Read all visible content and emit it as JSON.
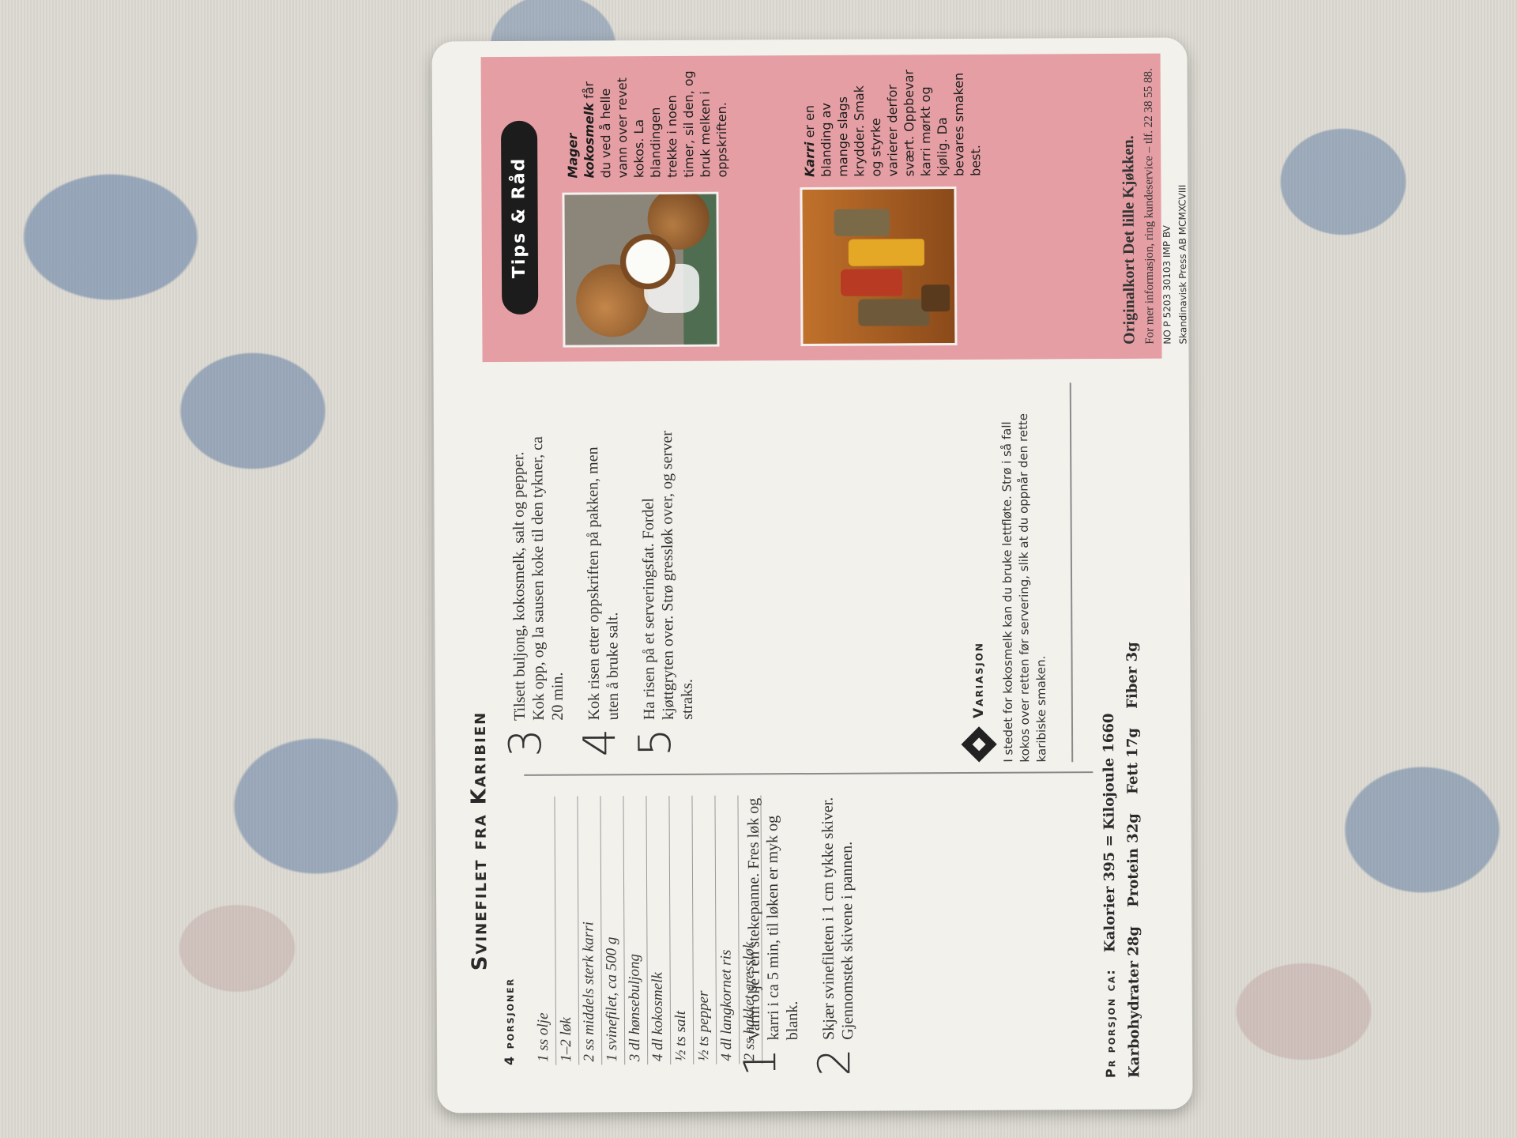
{
  "recipe": {
    "title": "Svinefilet fra Karibien",
    "servings": "4 porsjoner",
    "ingredients": [
      "1 ss olje",
      "1–2 løk",
      "2 ss middels sterk karri",
      "1 svinefilet, ca 500 g",
      "3 dl hønsebuljong",
      "4 dl kokosmelk",
      "½ ts salt",
      "½ ts pepper",
      "4 dl langkornet ris",
      "2 ss hakket gressløk"
    ],
    "steps": [
      {
        "num": "1",
        "text": "Varm olje i en stekepanne. Fres løk og karri i ca 5 min, til løken er myk og blank."
      },
      {
        "num": "2",
        "text": "Skjær svinefileten i 1 cm tykke skiver. Gjennomstek skivene i pannen."
      },
      {
        "num": "3",
        "text": "Tilsett buljong, kokosmelk, salt og pepper. Kok opp, og la sausen koke til den tykner, ca 20 min."
      },
      {
        "num": "4",
        "text": "Kok risen etter oppskriften på pakken, men uten å bruke salt."
      },
      {
        "num": "5",
        "text": "Ha risen på et serveringsfat. Fordel kjøttgryten over. Strø gressløk over, og server straks."
      }
    ],
    "variation": {
      "heading": "Variasjon",
      "text": "I stedet for kokosmelk kan du bruke lettfløte. Strø i så fall kokos over retten før servering, slik at du oppnår den rette karibiske smaken."
    },
    "nutrition": {
      "label": "Pr porsjon ca:",
      "line1": "Kalorier 395 = Kilojoule 1660",
      "carbs": "Karbohydrater 28g",
      "protein": "Protein 32g",
      "fat": "Fett 17g",
      "fiber": "Fiber 3g"
    }
  },
  "tips": {
    "badge": "Tips & Råd",
    "tip1_bold": "Mager kokosmelk",
    "tip1_text": " får du ved å helle vann over revet kokos. La blandingen trekke i noen timer, sil den, og bruk melken i oppskriften.",
    "tip2_bold": "Karri",
    "tip2_text": " er en blanding av mange slags krydder. Smak og styrke varierer derfor svært. Oppbevar karri mørkt og kjølig. Da bevares smaken best."
  },
  "footer": {
    "origin": "Originalkort Det lille Kjøkken.",
    "info": "For mer informasjon, ring kundeservice – tlf. 22 38 55 88.",
    "code1": "NO P 5203 30103 IMP BV",
    "code2": "Skandinavisk Press AB MCMXCVIII"
  },
  "colors": {
    "tips_panel": "#e59fa4",
    "card": "#f3f1ec"
  }
}
